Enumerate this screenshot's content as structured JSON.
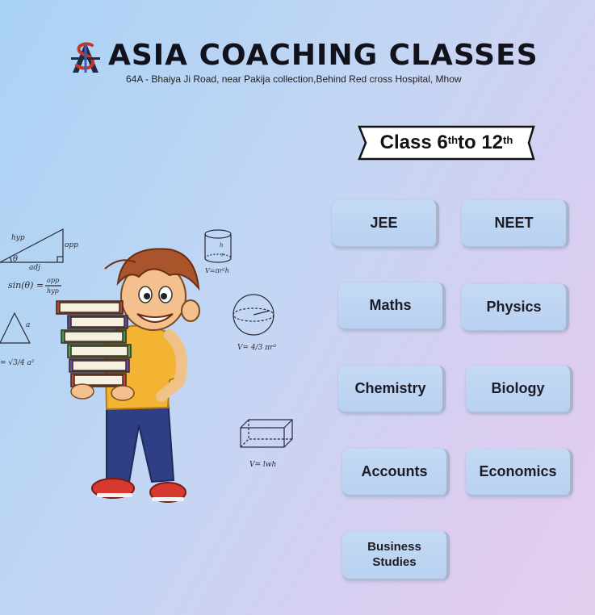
{
  "header": {
    "title": "ASIA COACHING CLASSES",
    "address": "64A - Bhaiya Ji Road, near Pakija collection,Behind Red cross Hospital, Mhow"
  },
  "badge": {
    "prefix": "Class 6",
    "sup1": "th",
    "middle": " to 12",
    "sup2": "th"
  },
  "courses": {
    "jee": "JEE",
    "neet": "NEET",
    "maths": "Maths",
    "physics": "Physics",
    "chemistry": "Chemistry",
    "biology": "Biology",
    "accounts": "Accounts",
    "economics": "Economics",
    "business_line1": "Business",
    "business_line2": "Studies"
  },
  "formulas": {
    "hyp": "hyp",
    "opp": "opp",
    "adj": "adj",
    "sin": "sin(θ) =",
    "theta": "θ",
    "frac_top": "opp",
    "frac_bottom": "hyp",
    "tri_a": "a",
    "tri_eq": "= √3/4 a²",
    "cyl": "V=πr²h",
    "sphere": "V= 4/3 πr³",
    "cuboid": "V= lwh",
    "cyl_h": "h",
    "cyl_r": "r"
  },
  "colors": {
    "bg_left": "#a9d2f5",
    "bg_right": "#e3cdef",
    "button": "#c4daf4",
    "text": "#12121c"
  },
  "icons": {
    "logo": "asia-logo-icon",
    "boy": "boy-with-books-illustration"
  }
}
